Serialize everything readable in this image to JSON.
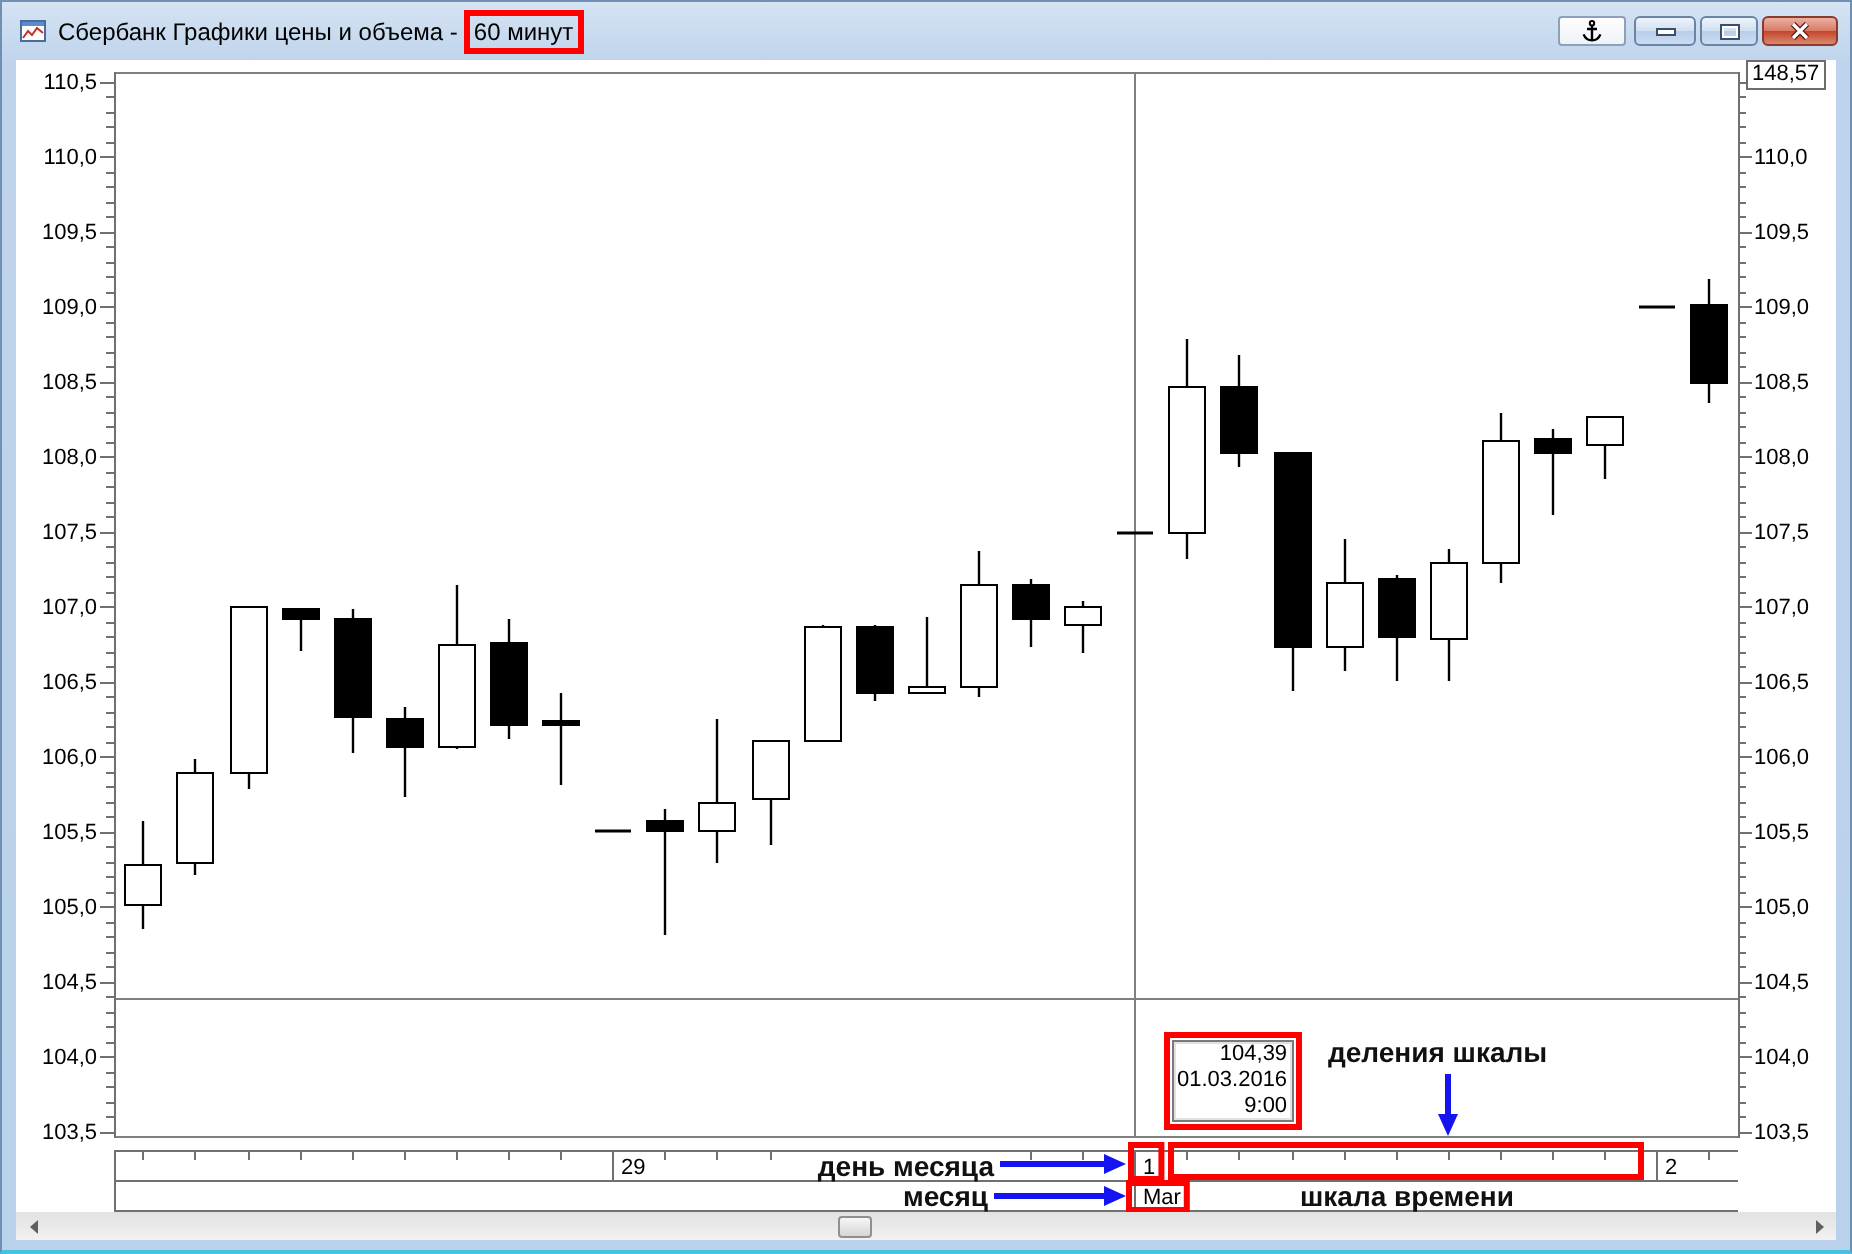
{
  "window": {
    "title": "Сбербанк Графики цены и объема -",
    "interval": {
      "text": "60 минут",
      "highlighted": true
    }
  },
  "chart": {
    "axis_badge": "148,57",
    "left_axis_labels": [
      "110,5",
      "110,0",
      "109,5",
      "109,0",
      "108,5",
      "108,0",
      "107,5",
      "107,0",
      "106,5",
      "106,0",
      "105,5",
      "105,0",
      "104,5",
      "104,0",
      "103,5"
    ],
    "right_axis_labels": [
      "110,0",
      "109,5",
      "109,0",
      "108,5",
      "108,0",
      "107,5",
      "107,0",
      "106,5",
      "106,0",
      "105,5",
      "105,0",
      "104,5",
      "104,0",
      "103,5"
    ],
    "cursor_info": {
      "value": "104,39",
      "date": "01.03.2016",
      "time": "9:00",
      "highlighted": true
    }
  },
  "time_axis": {
    "day_marks": [
      {
        "label": "29",
        "highlighted": false,
        "ticks_highlighted": false
      },
      {
        "label": "1",
        "highlighted": true,
        "ticks_highlighted": true,
        "month": {
          "label": "Mar",
          "highlighted": true
        }
      },
      {
        "label": "2",
        "highlighted": false,
        "ticks_highlighted": false
      }
    ]
  },
  "callouts": [
    {
      "text": "деления шкалы",
      "kind": "arrow-down"
    },
    {
      "text": "день месяца",
      "kind": "arrow-right"
    },
    {
      "text": "месяц",
      "kind": "arrow-right"
    },
    {
      "text": "шкала времени",
      "kind": "plain"
    }
  ]
}
